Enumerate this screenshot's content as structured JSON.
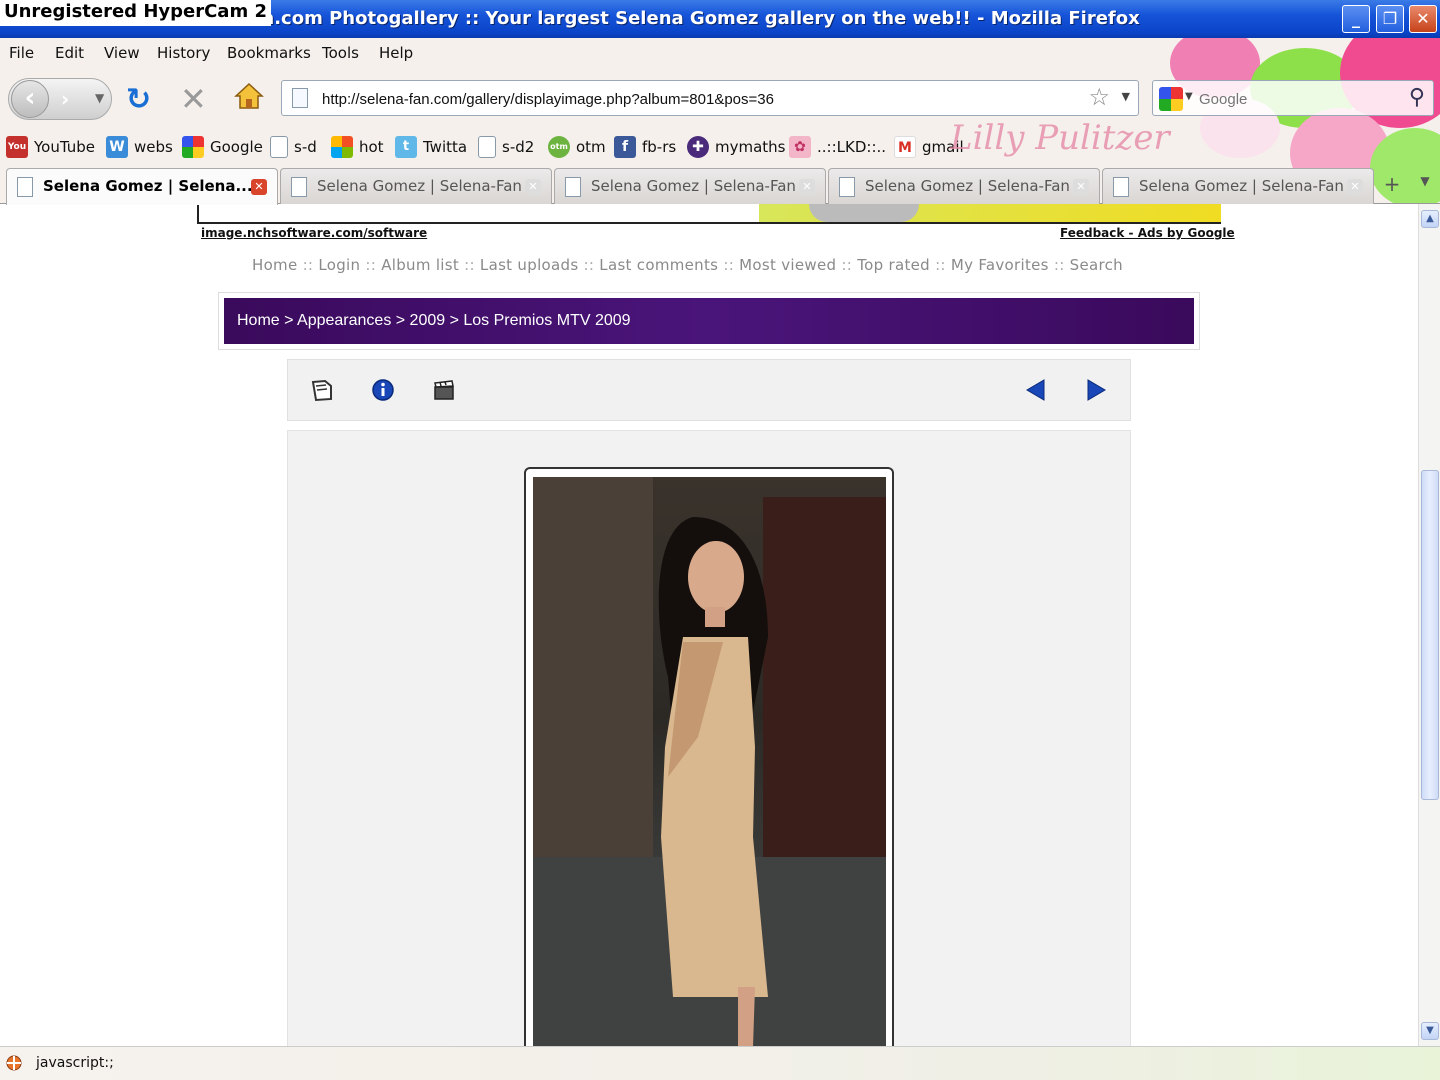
{
  "window": {
    "title": "Fan.com Photogallery :: Your largest Selena Gomez gallery on the web!! - Mozilla Firefox",
    "watermark": "Unregistered HyperCam 2",
    "minimize": "_",
    "restore": "❐",
    "close": "✕"
  },
  "menubar": {
    "items": [
      "File",
      "Edit",
      "View",
      "History",
      "Bookmarks",
      "Tools",
      "Help"
    ]
  },
  "navigation": {
    "back_icon": "back-arrow-icon",
    "forward_icon": "forward-arrow-icon",
    "reload_icon": "reload-icon",
    "stop_icon": "stop-icon",
    "home_icon": "home-icon",
    "url": "http://selena-fan.com/gallery/displayimage.php?album=801&pos=36",
    "search_placeholder": "Google"
  },
  "bookmarks": [
    {
      "label": "YouTube",
      "icon": "youtube-icon"
    },
    {
      "label": "webs",
      "icon": "webs-icon"
    },
    {
      "label": "Google",
      "icon": "google-icon"
    },
    {
      "label": "s-d",
      "icon": "page-icon"
    },
    {
      "label": "hot",
      "icon": "windows-icon"
    },
    {
      "label": "Twitta",
      "icon": "twitter-icon"
    },
    {
      "label": "s-d2",
      "icon": "page-icon"
    },
    {
      "label": "otm",
      "icon": "otm-icon"
    },
    {
      "label": "fb-rs",
      "icon": "facebook-icon"
    },
    {
      "label": "mymaths",
      "icon": "mymaths-icon"
    },
    {
      "label": "..::LKD::..",
      "icon": "flower-icon"
    },
    {
      "label": "gmail",
      "icon": "gmail-icon"
    }
  ],
  "tabs": [
    {
      "label": "Selena Gomez | Selena...",
      "active": true
    },
    {
      "label": "Selena Gomez | Selena-Fan...",
      "active": false
    },
    {
      "label": "Selena Gomez | Selena-Fan...",
      "active": false
    },
    {
      "label": "Selena Gomez | Selena-Fan...",
      "active": false
    },
    {
      "label": "Selena Gomez | Selena-Fan...",
      "active": false
    }
  ],
  "page": {
    "ad_left_link": "image.nchsoftware.com/software",
    "ad_right_link": "Feedback - Ads by Google",
    "topnav": [
      "Home",
      "Login",
      "Album list",
      "Last uploads",
      "Last comments",
      "Most viewed",
      "Top rated",
      "My Favorites",
      "Search"
    ],
    "breadcrumb": "Home > Appearances > 2009 > Los Premios MTV 2009",
    "toolbar_icons": [
      "return-thumbnails-icon",
      "info-icon",
      "slideshow-icon",
      "previous-icon",
      "next-icon"
    ]
  },
  "status": {
    "text": "javascript:;"
  },
  "colors": {
    "titlebar": "#0b45c9",
    "breadcrumb_bg": "#3a0a5c",
    "nav_blue": "#1a47b8"
  }
}
